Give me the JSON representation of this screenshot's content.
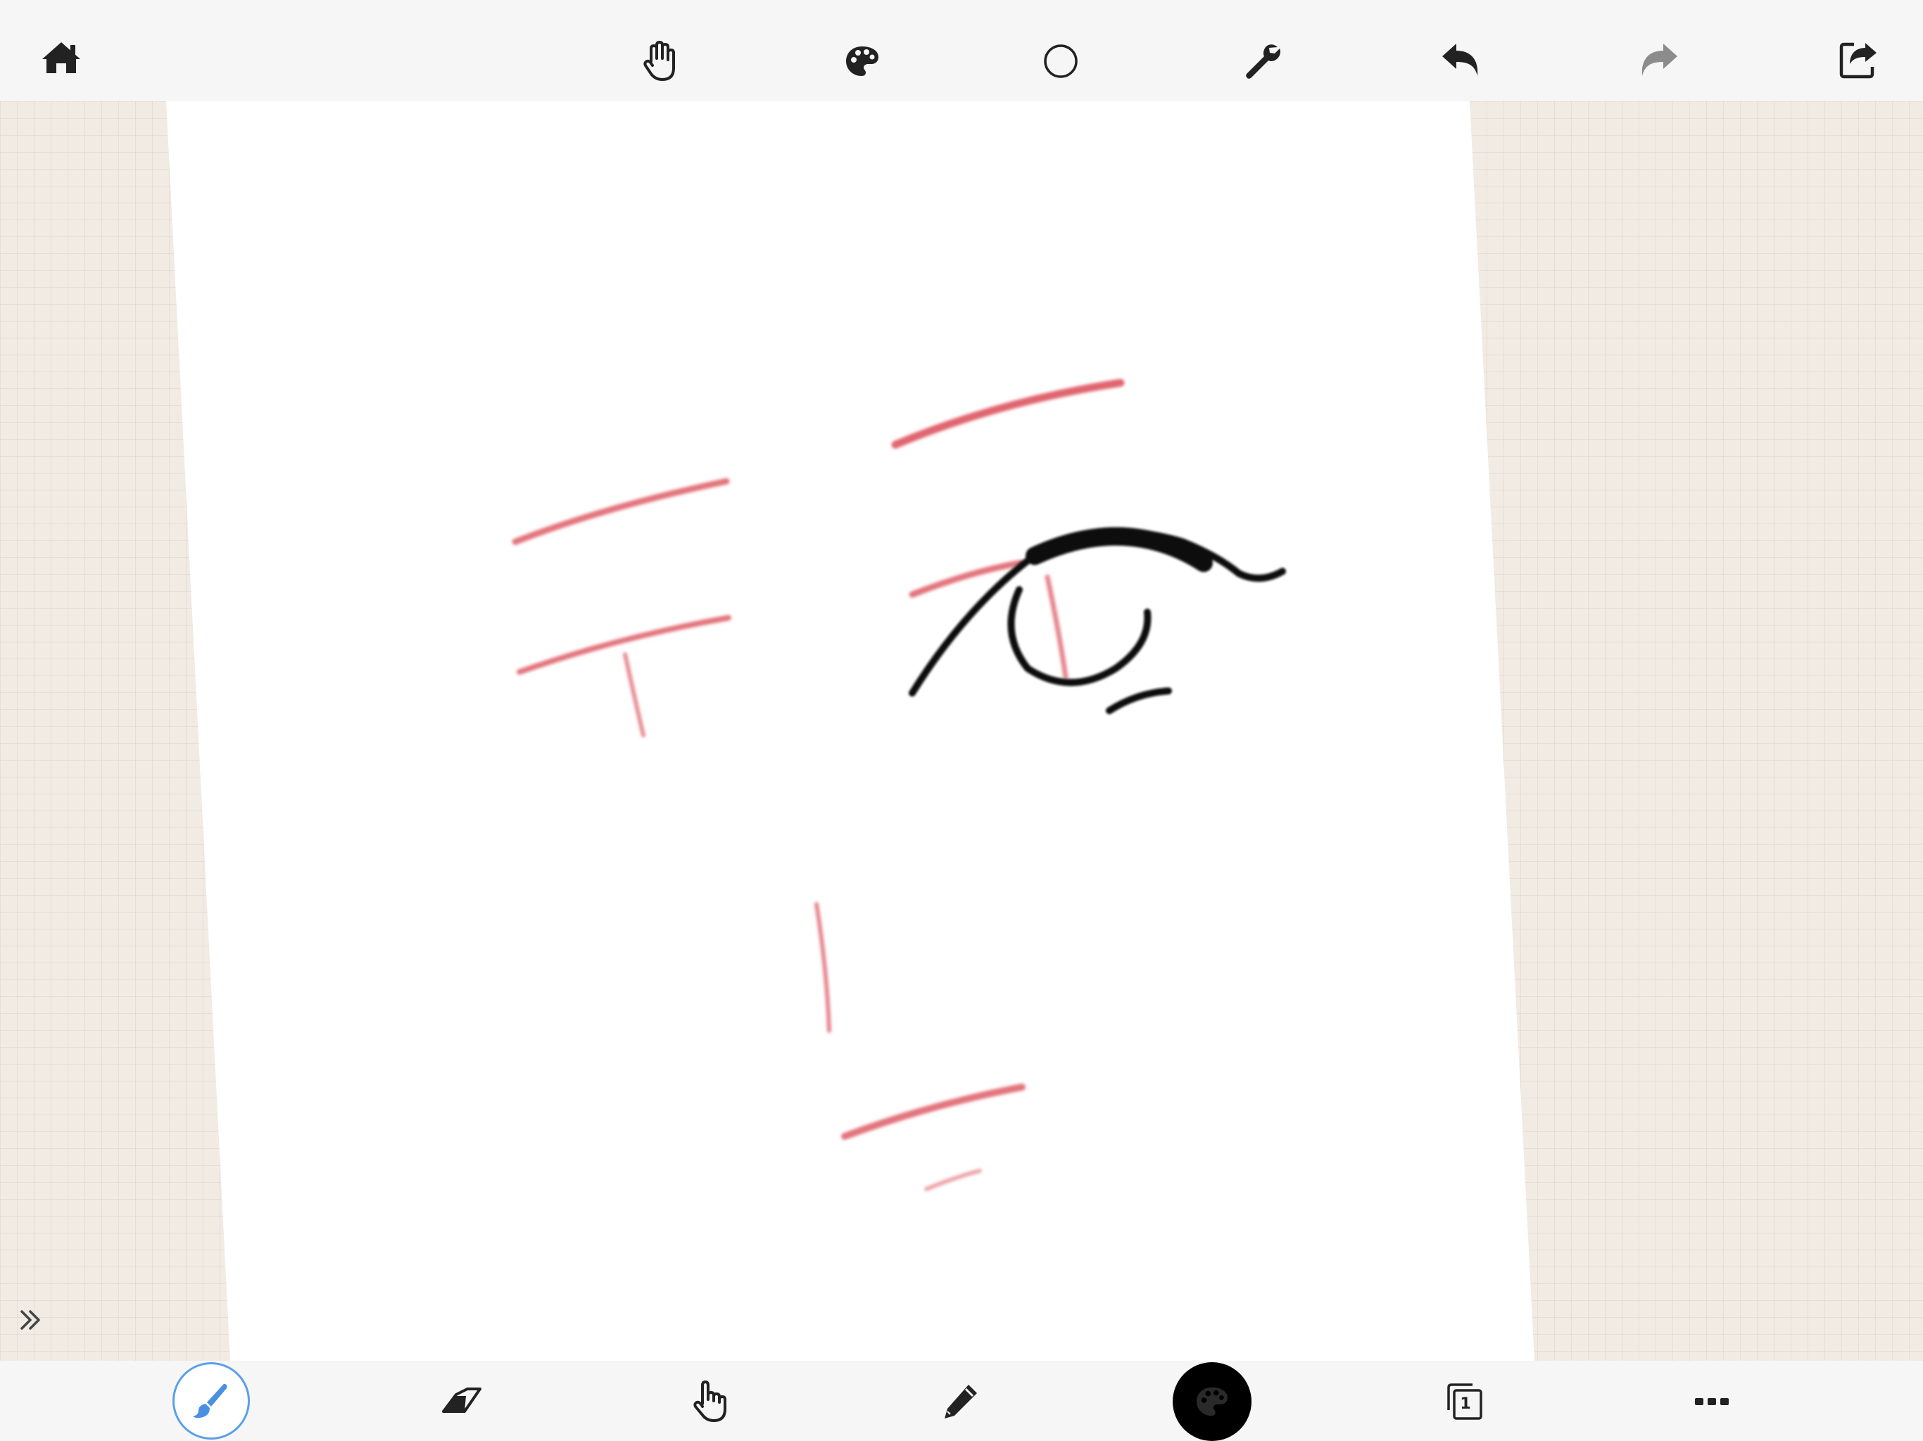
{
  "app": {
    "background_color": "#f1ebe4",
    "toolbar_color": "#f6f6f6",
    "accent_color": "#5aa0e8",
    "sketch_color": "#e0656f",
    "ink_color": "#111111"
  },
  "top_toolbar": {
    "items": [
      {
        "id": "home",
        "icon": "home-icon"
      },
      {
        "id": "hand",
        "icon": "hand-icon"
      },
      {
        "id": "palette",
        "icon": "palette-icon"
      },
      {
        "id": "shape",
        "icon": "circle-icon"
      },
      {
        "id": "settings",
        "icon": "wrench-icon"
      },
      {
        "id": "undo",
        "icon": "undo-icon"
      },
      {
        "id": "redo",
        "icon": "redo-icon",
        "enabled": false
      },
      {
        "id": "share",
        "icon": "share-icon"
      }
    ]
  },
  "bottom_toolbar": {
    "items": [
      {
        "id": "brush",
        "icon": "brush-icon",
        "active": true
      },
      {
        "id": "eraser",
        "icon": "eraser-icon"
      },
      {
        "id": "smudge",
        "icon": "pointer-hand-icon"
      },
      {
        "id": "pencil",
        "icon": "pencil-icon"
      },
      {
        "id": "color",
        "icon": "palette-icon",
        "current_color": "#000000"
      },
      {
        "id": "layers",
        "icon": "layers-icon"
      },
      {
        "id": "more",
        "icon": "more-icon"
      }
    ],
    "layer_count": "1"
  },
  "side_panel": {
    "expand_icon": "double-chevron-right-icon"
  }
}
